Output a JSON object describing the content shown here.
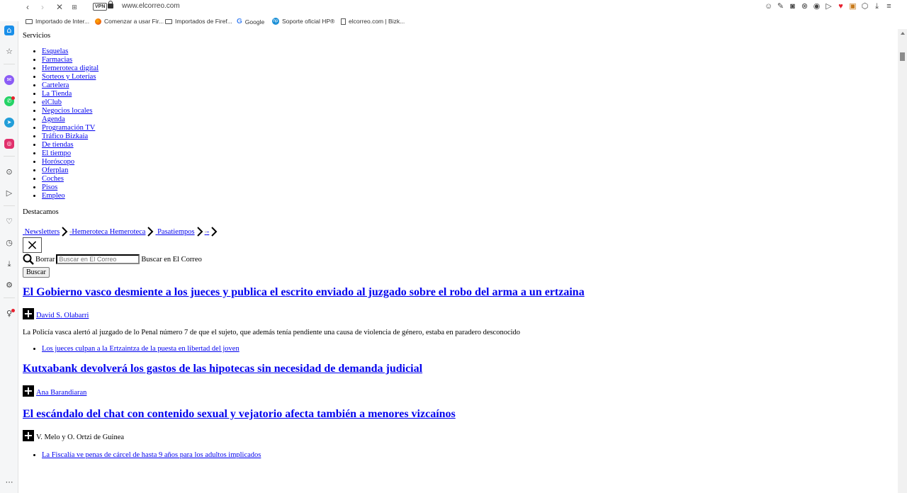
{
  "browser": {
    "url": "www.elcorreo.com",
    "vpn_label": "VPN",
    "bookmarks": [
      "Importado de Inter...",
      "Comenzar a usar Fir...",
      "Importados de Firef...",
      "Google",
      "Soporte oficial HP®",
      "elcorreo.com | Bizk..."
    ]
  },
  "services": {
    "title": "Servicios",
    "items": [
      "Esquelas",
      "Farmacias",
      "Hemeroteca digital",
      "Sorteos y Loterías",
      "Cartelera",
      "La Tienda",
      "elClub",
      "Negocios locales",
      "Agenda",
      "Programación TV",
      "Tráfico Bizkaia",
      "De tiendas",
      "El tiempo",
      "Horóscopo",
      "Oferplan",
      "Coches",
      "Pisos",
      "Empleo"
    ]
  },
  "highlights": {
    "title": "Destacamos",
    "newsletters": "Newsletters",
    "hemeroteca_img_alt": "Hemeroteca",
    "hemeroteca_label": "Hemeroteca",
    "pasatiempos": "Pasatiempos",
    "extra_img_alt": "-"
  },
  "search": {
    "clear_label": "Borrar",
    "placeholder": "Buscar en El Correo",
    "label": "Buscar en El Correo",
    "button": "Buscar"
  },
  "articles": [
    {
      "headline": "El Gobierno vasco desmiente a los jueces y publica el escrito enviado al juzgado sobre el robo del arma a un ertzaina",
      "author": "David S. Olabarri",
      "summary": "La Policía vasca alertó al juzgado de lo Penal número 7 de que el sujeto, que además tenía pendiente una causa de violencia de género, estaba en paradero desconocido",
      "related": "Los jueces culpan a la Ertzaintza de la puesta en libertad del joven"
    },
    {
      "headline": "Kutxabank devolverá los gastos de las hipotecas sin necesidad de demanda judicial",
      "author": "Ana Barandiaran"
    },
    {
      "headline": "El escándalo del chat con contenido sexual y vejatorio afecta también a menores vizcaínos",
      "author": "V. Melo y O. Ortzi de Guinea",
      "related": "La Fiscalía ve penas de cárcel de hasta 9 años para los adultos implicados"
    }
  ],
  "colors": {
    "link": "#0000ee",
    "accent": "#e8202e",
    "sidebar_home": "#1a8fe9"
  }
}
